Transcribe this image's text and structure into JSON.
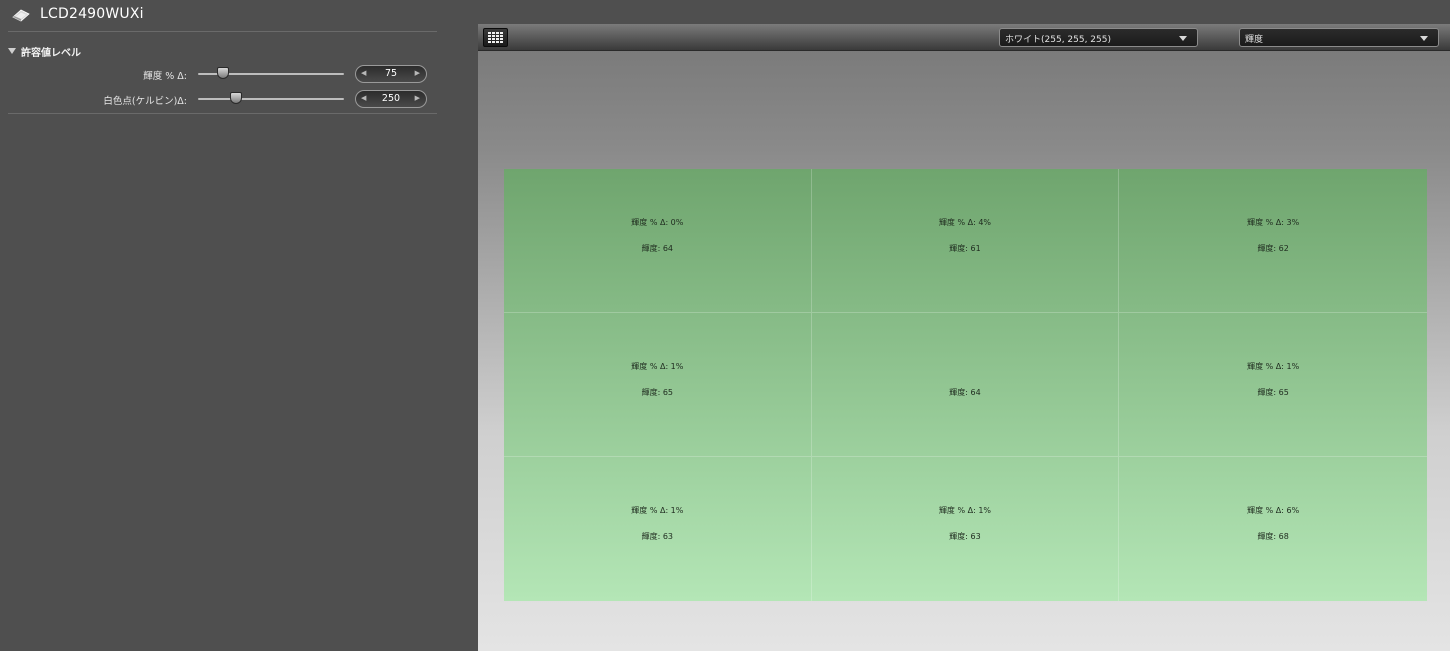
{
  "app": {
    "title": "LCD2490WUXi",
    "logo_icon": "monitor-logo-icon"
  },
  "tolerance": {
    "section_title": "許容値レベル",
    "luminance": {
      "label": "輝度 % Δ:",
      "value": "75",
      "slider_fraction": 0.17
    },
    "whitepoint": {
      "label": "白色点(ケルビン)Δ:",
      "value": "250",
      "slider_fraction": 0.26
    }
  },
  "toolbar": {
    "grid_icon": "grid-layout-icon",
    "color_dropdown": "ホワイト(255, 255, 255)",
    "measure_dropdown": "輝度"
  },
  "grid": {
    "colors": {
      "top": "#6fa56e",
      "bottom": "#b4e6b6"
    },
    "cells": [
      {
        "delta": "輝度 % Δ: 0%",
        "luminance": "輝度: 64"
      },
      {
        "delta": "輝度 % Δ: 4%",
        "luminance": "輝度: 61"
      },
      {
        "delta": "輝度 % Δ: 3%",
        "luminance": "輝度: 62"
      },
      {
        "delta": "輝度 % Δ: 1%",
        "luminance": "輝度: 65"
      },
      {
        "delta": "",
        "luminance": "輝度: 64"
      },
      {
        "delta": "輝度 % Δ: 1%",
        "luminance": "輝度: 65"
      },
      {
        "delta": "輝度 % Δ: 1%",
        "luminance": "輝度: 63"
      },
      {
        "delta": "輝度 % Δ: 1%",
        "luminance": "輝度: 63"
      },
      {
        "delta": "輝度 % Δ: 6%",
        "luminance": "輝度: 68"
      }
    ]
  }
}
